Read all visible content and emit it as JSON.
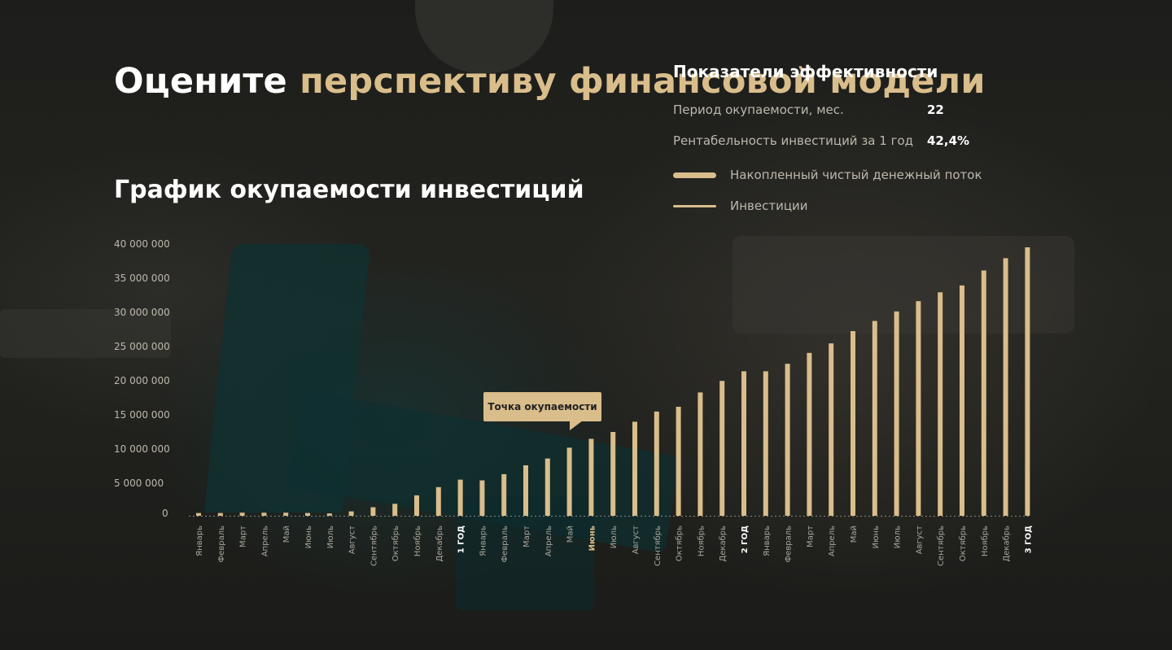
{
  "heading": {
    "title_white": "Оцените",
    "title_accent": "перспективу финансовой модели",
    "subtitle": "График окупаемости инвестиций"
  },
  "kpi": {
    "heading": "Показатели эффективности",
    "payback_label": "Период окупаемости, мес.",
    "payback_value": "22",
    "roi_label": "Рентабельность инвестиций за 1 год",
    "roi_value": "42,4%"
  },
  "colors": {
    "accent": "#d9bd8b",
    "text_muted": "#bdb8ad",
    "highlight_label": "#d9bd8b"
  },
  "chart_data": {
    "type": "bar",
    "ylim": [
      0,
      40000000
    ],
    "yticks": [
      "40 000 000",
      "35 000 000",
      "30 000 000",
      "25 000 000",
      "20 000 000",
      "15 000 000",
      "10 000 000",
      "5 000 000",
      "0"
    ],
    "legend": [
      "Накопленный чистый денежный поток",
      "Инвестиции"
    ],
    "annotation": "Точка окупаемости",
    "categories": [
      "Январь",
      "Февраль",
      "Март",
      "Апрель",
      "Май",
      "Июнь",
      "Июль",
      "Август",
      "Сентябрь",
      "Октябрь",
      "Ноябрь",
      "Декабрь",
      "1 ГОД",
      "Январь",
      "Февраль",
      "Март",
      "Апрель",
      "Май",
      "Июнь",
      "Июль",
      "Август",
      "Сентябрь",
      "Октябрь",
      "Ноябрь",
      "Декабрь",
      "2 ГОД",
      "Январь",
      "Февраль",
      "Март",
      "Апрель",
      "Май",
      "Июнь",
      "Июль",
      "Август",
      "Сентябрь",
      "Октябрь",
      "Ноябрь",
      "Декабрь",
      "3 ГОД"
    ],
    "bold_categories": [
      "1 ГОД",
      "2 ГОД",
      "3 ГОД"
    ],
    "highlight_category_index": 18,
    "annotation_category_index": 18,
    "values": [
      400000,
      400000,
      450000,
      450000,
      450000,
      400000,
      350000,
      650000,
      1250000,
      1750000,
      3000000,
      4200000,
      5300000,
      5200000,
      6100000,
      7400000,
      8400000,
      10000000,
      11300000,
      12300000,
      13800000,
      15300000,
      16000000,
      18100000,
      19800000,
      21200000,
      21200000,
      22300000,
      23900000,
      25300000,
      27100000,
      28600000,
      30000000,
      31500000,
      32800000,
      33800000,
      36000000,
      37800000,
      39400000
    ]
  }
}
